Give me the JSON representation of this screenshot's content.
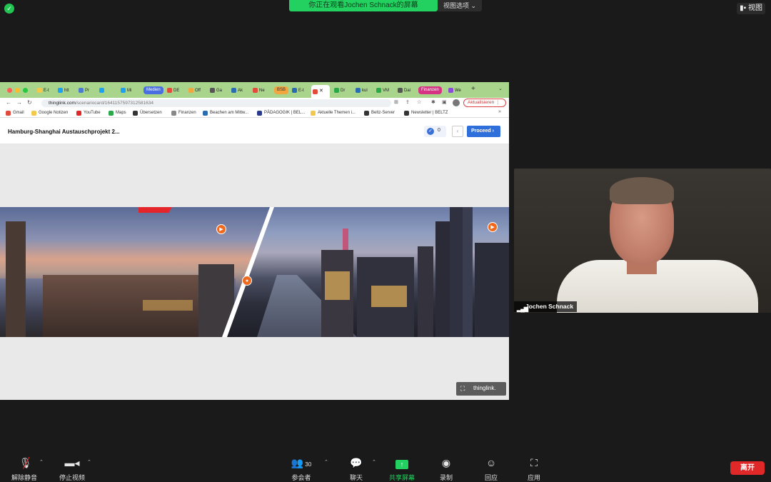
{
  "zoom": {
    "share_banner": "你正在观看Jochen Schnack的屏幕",
    "view_options": "视图选项",
    "view_button": "视图",
    "participant_name": "Jochen Schnack"
  },
  "browser": {
    "tabs": [
      {
        "label": "E-t",
        "color": "#f2c94c"
      },
      {
        "label": "htt",
        "color": "#1da1f2"
      },
      {
        "label": "Pr",
        "color": "#4a7bd0"
      },
      {
        "label": "",
        "color": "#1da1f2"
      },
      {
        "label": "Mi",
        "color": "#1da1f2"
      },
      {
        "label": "DE",
        "color": "#e24a3b"
      },
      {
        "label": "Off",
        "color": "#f2a640"
      },
      {
        "label": "Ga",
        "color": "#555"
      },
      {
        "label": "Ak",
        "color": "#2b6cb0"
      },
      {
        "label": "Ne",
        "color": "#e24a3b"
      },
      {
        "label": "E-t",
        "color": "#2b6cb0"
      },
      {
        "label": "Dr",
        "color": "#2aa84a"
      },
      {
        "label": "kul",
        "color": "#2b6cb0"
      },
      {
        "label": "VM",
        "color": "#2aa84a"
      },
      {
        "label": "Dai",
        "color": "#555"
      },
      {
        "label": "We",
        "color": "#8a4bd8"
      }
    ],
    "groups": {
      "medien": "Medien",
      "bsb": "BSB",
      "finanzen": "Finanzen"
    },
    "url_domain": "thinglink.com",
    "url_path": "/scenariocard/1641157597312581634",
    "update_button": "Aktualisieren",
    "bookmarks": [
      {
        "label": "Gmail",
        "color": "#e24a3b"
      },
      {
        "label": "Google Notizen",
        "color": "#f2c94c"
      },
      {
        "label": "YouTube",
        "color": "#e02828"
      },
      {
        "label": "Maps",
        "color": "#2aa84a"
      },
      {
        "label": "Übersetzen",
        "color": "#333"
      },
      {
        "label": "Finanzen",
        "color": "#888"
      },
      {
        "label": "Beachen am Mittw...",
        "color": "#2b6cb0"
      },
      {
        "label": "PÄDAGOGIK | BEL...",
        "color": "#2b3a8c"
      },
      {
        "label": "Aktuelle Themen i...",
        "color": "#f2c94c"
      },
      {
        "label": "Beltz-Server",
        "color": "#333"
      },
      {
        "label": "Newsletter | BELTZ",
        "color": "#333"
      }
    ]
  },
  "thinglink": {
    "title": "Hamburg-Shanghai Austauschprojekt 2...",
    "count": "0",
    "proceed": "Proceed",
    "brand": "thinglink."
  },
  "toolbar": {
    "unmute": "解除静音",
    "stop_video": "停止视频",
    "participants": "参会者",
    "participants_count": "30",
    "chat": "聊天",
    "share_screen": "共享屏幕",
    "record": "录制",
    "reactions": "回应",
    "apps": "应用",
    "leave": "离开"
  }
}
